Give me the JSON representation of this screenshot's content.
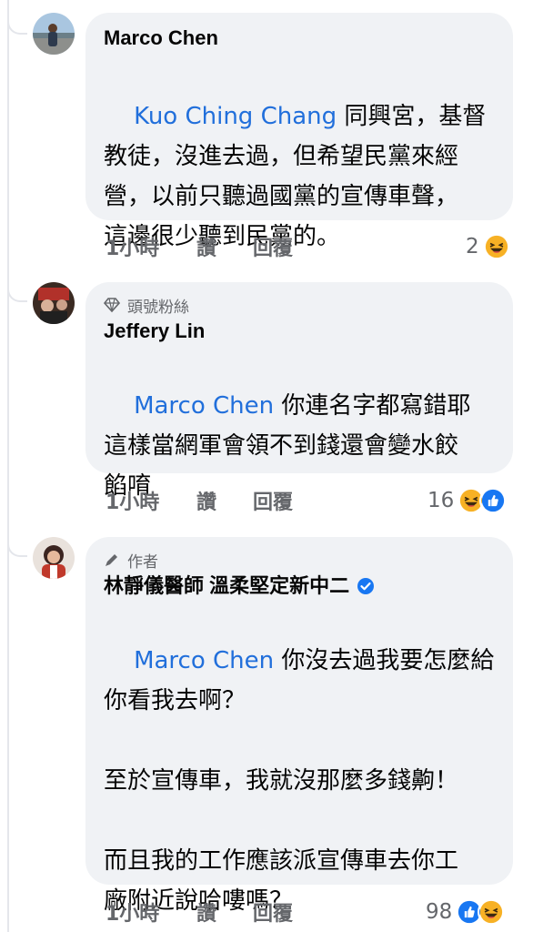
{
  "comments": [
    {
      "author": "Marco Chen",
      "badge": "",
      "mention": "Kuo Ching Chang",
      "lines": [
        "同興宮，基督",
        "教徒，沒進去過，但希望民黨來經",
        "營，以前只聽過國黨的宣傳車聲，",
        "這邊很少聽到民黨的。"
      ],
      "time": "1小時",
      "like_label": "讚",
      "reply_label": "回覆",
      "reaction_count": "2",
      "reactions": [
        "haha"
      ]
    },
    {
      "author": "Jeffery Lin",
      "badge": "頭號粉絲",
      "mention": "Marco Chen",
      "lines": [
        "你連名字都寫錯耶",
        "這樣當網軍會領不到錢還會變水餃",
        "餡唷"
      ],
      "time": "1小時",
      "like_label": "讚",
      "reply_label": "回覆",
      "reaction_count": "16",
      "reactions": [
        "haha",
        "like"
      ]
    },
    {
      "author": "林靜儀醫師 溫柔堅定新中二",
      "badge": "作者",
      "verified": true,
      "mention": "Marco Chen",
      "lines": [
        "你沒去過我要怎麼給",
        "你看我去啊？",
        "",
        "至於宣傳車，我就沒那麼多錢齁！",
        "",
        "而且我的工作應該派宣傳車去你工",
        "廠附近說哈嘍嗎？"
      ],
      "time": "1小時",
      "like_label": "讚",
      "reply_label": "回覆",
      "reaction_count": "98",
      "reactions": [
        "like",
        "haha"
      ]
    }
  ],
  "colors": {
    "mention": "#216fdb",
    "bubble": "#f0f2f5",
    "meta": "#65676b",
    "like": "#1877f2",
    "haha": "#f7b125"
  }
}
